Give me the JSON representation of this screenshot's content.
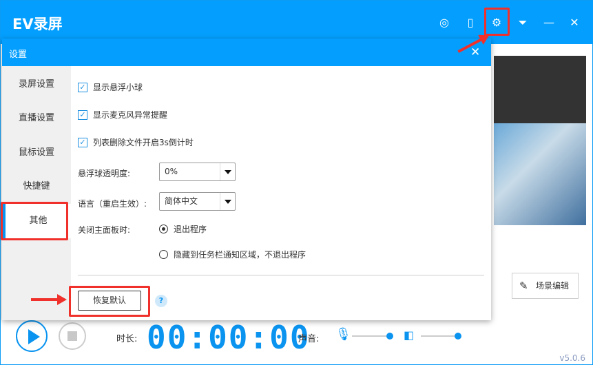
{
  "app": {
    "title": "EV录屏",
    "version": "v5.0.6",
    "scene_edit": "场景编辑",
    "duration_label": "时长:",
    "timer": "00:00:00",
    "sound_label": "声音:"
  },
  "header_icons": [
    "user-icon",
    "phone-icon",
    "gear-icon",
    "dropdown-icon",
    "minimize-icon",
    "close-icon"
  ],
  "dialog": {
    "title": "设置",
    "sidebar": [
      {
        "label": "录屏设置"
      },
      {
        "label": "直播设置"
      },
      {
        "label": "鼠标设置"
      },
      {
        "label": "快捷键"
      },
      {
        "label": "其他",
        "active": true
      }
    ],
    "checkboxes": [
      {
        "label": "显示悬浮小球",
        "checked": true
      },
      {
        "label": "显示麦克风异常提醒",
        "checked": true
      },
      {
        "label": "列表删除文件开启3s倒计时",
        "checked": true
      }
    ],
    "opacity": {
      "label": "悬浮球透明度:",
      "value": "0%"
    },
    "language": {
      "label": "语言（重启生效）:",
      "value": "简体中文"
    },
    "close_panel": {
      "label": "关闭主面板时:",
      "options": [
        {
          "label": "退出程序",
          "selected": true
        },
        {
          "label": "隐藏到任务栏通知区域，不退出程序",
          "selected": false
        }
      ]
    },
    "reset": "恢复默认",
    "help": "?"
  },
  "colors": {
    "accent": "#049ffe",
    "annotation": "#f0302a"
  }
}
